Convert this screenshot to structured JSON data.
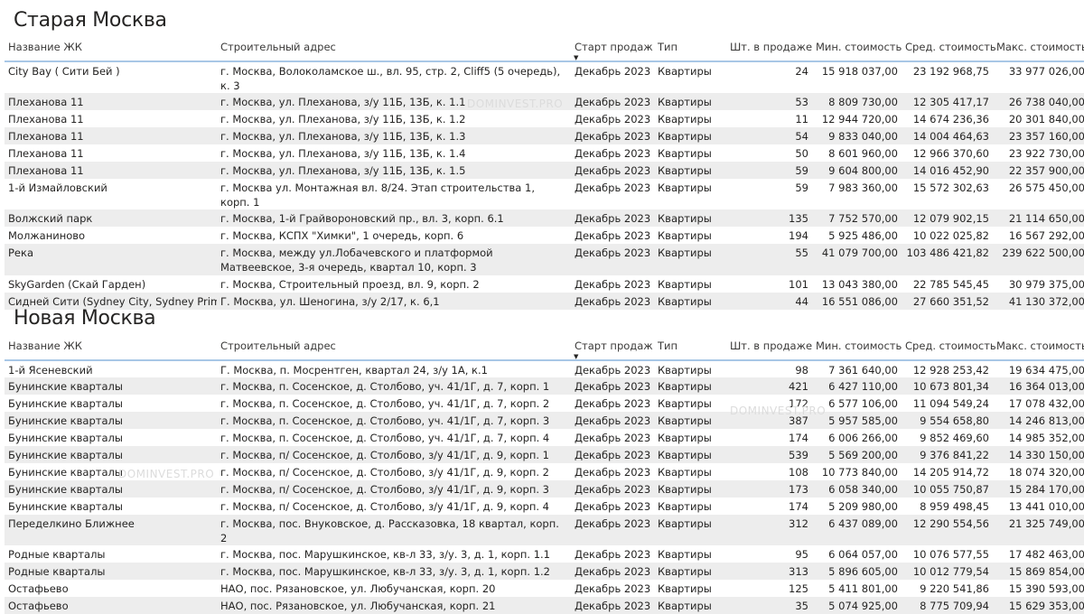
{
  "columns": [
    "Название ЖК",
    "Строительный адрес",
    "Старт продаж",
    "Тип",
    "Шт. в продаже",
    "Мин. стоимость",
    "Сред. стоимость",
    "Макс. стоимость"
  ],
  "sort_icon": "sort-descending-icon",
  "watermark_text": "DOMINVEST.PRO",
  "old_moscow": {
    "title": "Старая Москва",
    "rows": [
      {
        "name": "City Bay ( Сити Бей )",
        "address": "г. Москва, Волоколамское ш., вл. 95, стр. 2, Cliff5 (5 очередь), к. 3",
        "start": "Декабрь 2023",
        "type": "Квартиры",
        "count": "24",
        "min": "15 918 037,00",
        "avg": "23 192 968,75",
        "max": "33 977 026,00"
      },
      {
        "name": "Плеханова 11",
        "address": "г. Москва, ул. Плеханова, з/у 11Б, 13Б, к. 1.1",
        "start": "Декабрь 2023",
        "type": "Квартиры",
        "count": "53",
        "min": "8 809 730,00",
        "avg": "12 305 417,17",
        "max": "26 738 040,00"
      },
      {
        "name": "Плеханова 11",
        "address": "г. Москва, ул. Плеханова, з/у 11Б, 13Б, к. 1.2",
        "start": "Декабрь 2023",
        "type": "Квартиры",
        "count": "11",
        "min": "12 944 720,00",
        "avg": "14 674 236,36",
        "max": "20 301 840,00"
      },
      {
        "name": "Плеханова 11",
        "address": "г. Москва, ул. Плеханова, з/у 11Б, 13Б, к. 1.3",
        "start": "Декабрь 2023",
        "type": "Квартиры",
        "count": "54",
        "min": "9 833 040,00",
        "avg": "14 004 464,63",
        "max": "23 357 160,00"
      },
      {
        "name": "Плеханова 11",
        "address": "г. Москва, ул. Плеханова, з/у 11Б, 13Б, к. 1.4",
        "start": "Декабрь 2023",
        "type": "Квартиры",
        "count": "50",
        "min": "8 601 960,00",
        "avg": "12 966 370,60",
        "max": "23 922 730,00"
      },
      {
        "name": "Плеханова 11",
        "address": "г. Москва, ул. Плеханова, з/у 11Б, 13Б, к. 1.5",
        "start": "Декабрь 2023",
        "type": "Квартиры",
        "count": "59",
        "min": "9 604 800,00",
        "avg": "14 016 452,90",
        "max": "22 357 900,00"
      },
      {
        "name": "1-й Измайловский",
        "address": "г. Москва ул. Монтажная вл. 8/24. Этап строительства 1, корп. 1",
        "start": "Декабрь 2023",
        "type": "Квартиры",
        "count": "59",
        "min": "7 983 360,00",
        "avg": "15 572 302,63",
        "max": "26 575 450,00"
      },
      {
        "name": "Волжский парк",
        "address": "г. Москва, 1-й Грайвороновский пр., вл. 3, корп. 6.1",
        "start": "Декабрь 2023",
        "type": "Квартиры",
        "count": "135",
        "min": "7 752 570,00",
        "avg": "12 079 902,15",
        "max": "21 114 650,00"
      },
      {
        "name": "Молжаниново",
        "address": "г. Москва, КСПХ \"Химки\", 1 очередь, корп. 6",
        "start": "Декабрь 2023",
        "type": "Квартиры",
        "count": "194",
        "min": "5 925 486,00",
        "avg": "10 022 025,82",
        "max": "16 567 292,00"
      },
      {
        "name": "Река",
        "address": "г. Москва, между ул.Лобачевского и платформой Матвеевское, 3-я очередь, квартал 10, корп. 3",
        "start": "Декабрь 2023",
        "type": "Квартиры",
        "count": "55",
        "min": "41 079 700,00",
        "avg": "103 486 421,82",
        "max": "239 622 500,00"
      },
      {
        "name": "SkyGarden (Скай Гарден)",
        "address": "г. Москва, Строительный проезд, вл. 9, корп. 2",
        "start": "Декабрь 2023",
        "type": "Квартиры",
        "count": "101",
        "min": "13 043 380,00",
        "avg": "22 785 545,45",
        "max": "30 979 375,00"
      },
      {
        "name": "Сидней Сити (Sydney City, Sydney Prime)",
        "address": "Г. Москва, ул. Шеногина, з/у 2/17, к. 6,1",
        "start": "Декабрь 2023",
        "type": "Квартиры",
        "count": "44",
        "min": "16 551 086,00",
        "avg": "27 660 351,52",
        "max": "41 130 372,00"
      }
    ]
  },
  "new_moscow": {
    "title": "Новая Москва",
    "rows": [
      {
        "name": "1-й Ясеневский",
        "address": "Г. Москва, п. Мосрентген, квартал 24, з/у 1А, к.1",
        "start": "Декабрь 2023",
        "type": "Квартиры",
        "count": "98",
        "min": "7 361 640,00",
        "avg": "12 928 253,42",
        "max": "19 634 475,00"
      },
      {
        "name": "Бунинские кварталы",
        "address": "г. Москва, п. Сосенское, д. Столбово, уч. 41/1Г, д. 7, корп. 1",
        "start": "Декабрь 2023",
        "type": "Квартиры",
        "count": "421",
        "min": "6 427 110,00",
        "avg": "10 673 801,34",
        "max": "16 364 013,00"
      },
      {
        "name": "Бунинские кварталы",
        "address": "г. Москва, п. Сосенское, д. Столбово, уч. 41/1Г, д. 7, корп. 2",
        "start": "Декабрь 2023",
        "type": "Квартиры",
        "count": "172",
        "min": "6 577 106,00",
        "avg": "11 094 549,24",
        "max": "17 078 432,00"
      },
      {
        "name": "Бунинские кварталы",
        "address": "г. Москва, п. Сосенское, д. Столбово, уч. 41/1Г, д. 7, корп. 3",
        "start": "Декабрь 2023",
        "type": "Квартиры",
        "count": "387",
        "min": "5 957 585,00",
        "avg": "9 554 658,80",
        "max": "14 246 813,00"
      },
      {
        "name": "Бунинские кварталы",
        "address": "г. Москва, п. Сосенское, д. Столбово, уч. 41/1Г, д. 7, корп. 4",
        "start": "Декабрь 2023",
        "type": "Квартиры",
        "count": "174",
        "min": "6 006 266,00",
        "avg": "9 852 469,60",
        "max": "14 985 352,00"
      },
      {
        "name": "Бунинские кварталы",
        "address": "г. Москва, п/ Сосенское, д. Столбово, з/у 41/1Г, д. 9, корп. 1",
        "start": "Декабрь 2023",
        "type": "Квартиры",
        "count": "539",
        "min": "5 569 200,00",
        "avg": "9 376 841,22",
        "max": "14 330 150,00"
      },
      {
        "name": "Бунинские кварталы",
        "address": "г. Москва, п/ Сосенское, д. Столбово, з/у 41/1Г, д. 9, корп. 2",
        "start": "Декабрь 2023",
        "type": "Квартиры",
        "count": "108",
        "min": "10 773 840,00",
        "avg": "14 205 914,72",
        "max": "18 074 320,00"
      },
      {
        "name": "Бунинские кварталы",
        "address": "г. Москва, п/ Сосенское, д. Столбово, з/у 41/1Г, д. 9, корп. 3",
        "start": "Декабрь 2023",
        "type": "Квартиры",
        "count": "173",
        "min": "6 058 340,00",
        "avg": "10 055 750,87",
        "max": "15 284 170,00"
      },
      {
        "name": "Бунинские кварталы",
        "address": "г. Москва, п/ Сосенское, д. Столбово, з/у 41/1Г, д. 9, корп. 4",
        "start": "Декабрь 2023",
        "type": "Квартиры",
        "count": "174",
        "min": "5 209 980,00",
        "avg": "8 959 498,45",
        "max": "13 441 010,00"
      },
      {
        "name": "Переделкино Ближнее",
        "address": "г. Москва, пос. Внуковское, д. Рассказовка, 18 квартал, корп. 2",
        "start": "Декабрь 2023",
        "type": "Квартиры",
        "count": "312",
        "min": "6 437 089,00",
        "avg": "12 290 554,56",
        "max": "21 325 749,00"
      },
      {
        "name": "Родные кварталы",
        "address": "г. Москва, пос. Марушкинское, кв-л 33, з/у. 3, д. 1, корп. 1.1",
        "start": "Декабрь 2023",
        "type": "Квартиры",
        "count": "95",
        "min": "6 064 057,00",
        "avg": "10 076 577,55",
        "max": "17 482 463,00"
      },
      {
        "name": "Родные кварталы",
        "address": "г. Москва, пос. Марушкинское, кв-л 33, з/у. 3, д. 1, корп. 1.2",
        "start": "Декабрь 2023",
        "type": "Квартиры",
        "count": "313",
        "min": "5 896 605,00",
        "avg": "10 012 779,54",
        "max": "15 869 854,00"
      },
      {
        "name": "Остафьево",
        "address": "НАО, пос. Рязановское, ул. Любучанская, корп. 20",
        "start": "Декабрь 2023",
        "type": "Квартиры",
        "count": "125",
        "min": "5 411 801,00",
        "avg": "9 220 541,86",
        "max": "15 390 593,00"
      },
      {
        "name": "Остафьево",
        "address": "НАО, пос. Рязановское, ул. Любучанская, корп. 21",
        "start": "Декабрь 2023",
        "type": "Квартиры",
        "count": "35",
        "min": "5 074 925,00",
        "avg": "8 775 709,94",
        "max": "15 629 353,00"
      }
    ]
  }
}
